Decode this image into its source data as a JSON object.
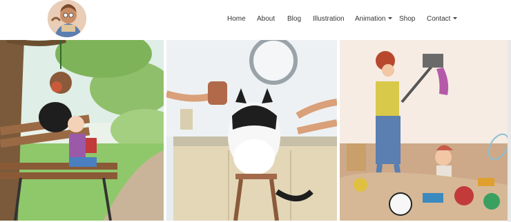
{
  "site": {
    "logo_icon": "cartoon-artist-portrait-icon"
  },
  "nav": {
    "items": [
      {
        "label": "Home",
        "dropdown": false
      },
      {
        "label": "About",
        "dropdown": false
      },
      {
        "label": "Blog",
        "dropdown": false
      },
      {
        "label": "Illustration",
        "dropdown": false
      },
      {
        "label": "Animation",
        "dropdown": true
      },
      {
        "label": "Shop",
        "dropdown": false
      },
      {
        "label": "Contact",
        "dropdown": true
      }
    ]
  },
  "gallery": {
    "tiles": [
      {
        "subject": "girl reading on park bench with monkey hanging from tree"
      },
      {
        "subject": "cat on stool being groomed with hair dryer and scissors"
      },
      {
        "subject": "mother vacuuming while child sits in pile of toys"
      }
    ]
  },
  "colors": {
    "nav_text": "#333333",
    "background": "#ffffff"
  }
}
